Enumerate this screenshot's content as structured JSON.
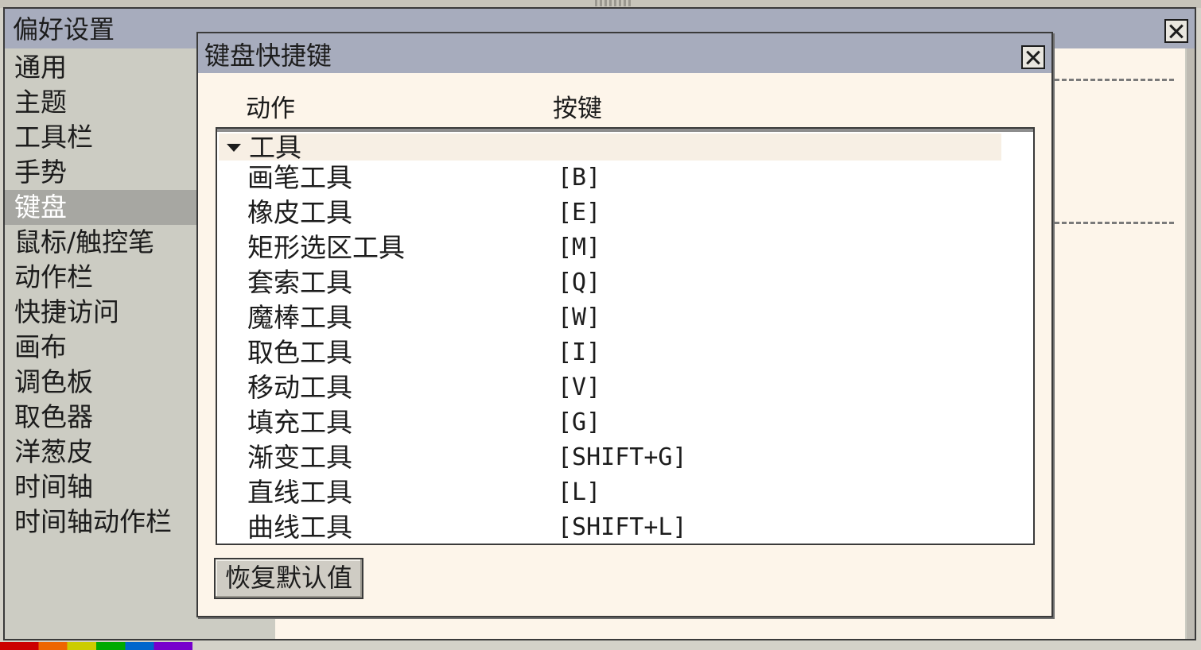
{
  "preferences": {
    "title": "偏好设置",
    "sidebar": [
      {
        "label": "通用"
      },
      {
        "label": "主题"
      },
      {
        "label": "工具栏"
      },
      {
        "label": "手势"
      },
      {
        "label": "键盘",
        "selected": true
      },
      {
        "label": "鼠标/触控笔"
      },
      {
        "label": "动作栏"
      },
      {
        "label": "快捷访问"
      },
      {
        "label": "画布"
      },
      {
        "label": "调色板"
      },
      {
        "label": "取色器"
      },
      {
        "label": "洋葱皮"
      },
      {
        "label": "时间轴"
      },
      {
        "label": "时间轴动作栏"
      }
    ]
  },
  "dialog": {
    "title": "键盘快捷键",
    "columns": {
      "action": "动作",
      "key": "按键"
    },
    "group": {
      "label": "工具",
      "expanded": true
    },
    "rows": [
      {
        "action": "画笔工具",
        "key": "[B]"
      },
      {
        "action": "橡皮工具",
        "key": "[E]"
      },
      {
        "action": "矩形选区工具",
        "key": "[M]"
      },
      {
        "action": "套索工具",
        "key": "[Q]"
      },
      {
        "action": "魔棒工具",
        "key": "[W]"
      },
      {
        "action": "取色工具",
        "key": "[I]"
      },
      {
        "action": "移动工具",
        "key": "[V]"
      },
      {
        "action": "填充工具",
        "key": "[G]"
      },
      {
        "action": "渐变工具",
        "key": "[SHIFT+G]"
      },
      {
        "action": "直线工具",
        "key": "[L]"
      },
      {
        "action": "曲线工具",
        "key": "[SHIFT+L]"
      }
    ],
    "restore_button": "恢复默认值"
  },
  "colors": {
    "titlebar": "#a7acbd",
    "dialog_bg": "#fdf5ea",
    "sidebar_bg": "#ccccc3",
    "selected_bg": "#a7a7a2"
  }
}
